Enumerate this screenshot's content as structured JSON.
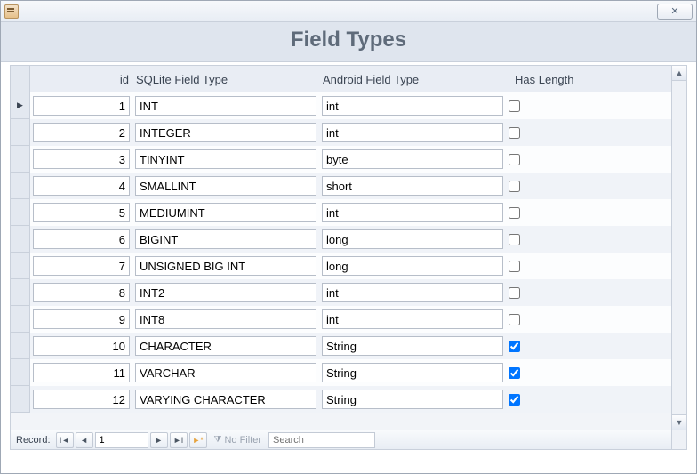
{
  "window": {
    "close_glyph": "✕"
  },
  "heading": "Field Types",
  "columns": {
    "id": "id",
    "sqlite": "SQLite Field Type",
    "android": "Android Field Type",
    "has_length": "Has Length"
  },
  "rows": [
    {
      "id": "1",
      "sqlite": "INT",
      "android": "int",
      "has_length": false
    },
    {
      "id": "2",
      "sqlite": "INTEGER",
      "android": "int",
      "has_length": false
    },
    {
      "id": "3",
      "sqlite": "TINYINT",
      "android": "byte",
      "has_length": false
    },
    {
      "id": "4",
      "sqlite": "SMALLINT",
      "android": "short",
      "has_length": false
    },
    {
      "id": "5",
      "sqlite": "MEDIUMINT",
      "android": "int",
      "has_length": false
    },
    {
      "id": "6",
      "sqlite": "BIGINT",
      "android": "long",
      "has_length": false
    },
    {
      "id": "7",
      "sqlite": "UNSIGNED BIG INT",
      "android": "long",
      "has_length": false
    },
    {
      "id": "8",
      "sqlite": "INT2",
      "android": "int",
      "has_length": false
    },
    {
      "id": "9",
      "sqlite": "INT8",
      "android": "int",
      "has_length": false
    },
    {
      "id": "10",
      "sqlite": "CHARACTER",
      "android": "String",
      "has_length": true
    },
    {
      "id": "11",
      "sqlite": "VARCHAR",
      "android": "String",
      "has_length": true
    },
    {
      "id": "12",
      "sqlite": "VARYING CHARACTER",
      "android": "String",
      "has_length": true
    }
  ],
  "nav": {
    "label": "Record:",
    "current": "1",
    "first": "I◄",
    "prev": "◄",
    "next": "►",
    "last": "►I",
    "new": "►*",
    "no_filter": "No Filter",
    "search_placeholder": "Search"
  }
}
